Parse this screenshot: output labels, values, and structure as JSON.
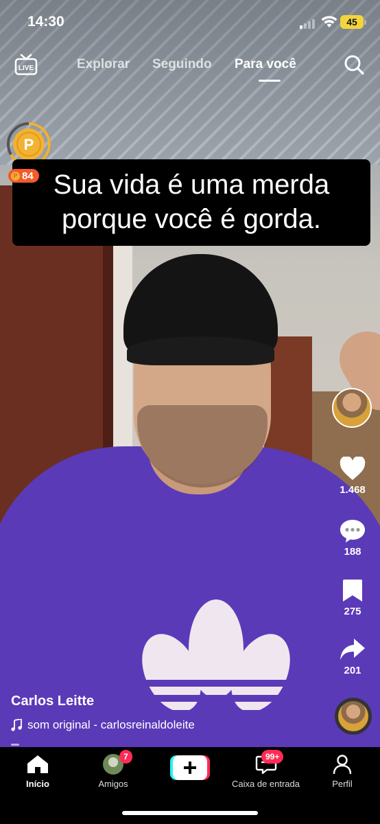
{
  "status_bar": {
    "time": "14:30",
    "battery": "45"
  },
  "top_nav": {
    "live_label": "LIVE",
    "tabs": [
      {
        "label": "Explorar",
        "active": false
      },
      {
        "label": "Seguindo",
        "active": false
      },
      {
        "label": "Para você",
        "active": true
      }
    ]
  },
  "coin": {
    "symbol": "P",
    "count": "84"
  },
  "caption": {
    "line1": "Sua vida é uma merda",
    "line2": "porque você é gorda."
  },
  "rail": {
    "likes": "1.468",
    "comments": "188",
    "saves": "275",
    "shares": "201"
  },
  "video": {
    "author": "Carlos Leitte",
    "sound": "som original - carlosreinaldoleite"
  },
  "tabbar": {
    "items": [
      {
        "label": "Início",
        "active": true
      },
      {
        "label": "Amigos",
        "badge": "7"
      },
      {
        "label": ""
      },
      {
        "label": "Caixa de entrada",
        "badge": "99+"
      },
      {
        "label": "Perfil"
      }
    ]
  },
  "colors": {
    "accent": "#fe2c55",
    "coin_orange": "#f25b2a",
    "battery": "#f2d53c",
    "shirt": "#5b3ab8"
  }
}
